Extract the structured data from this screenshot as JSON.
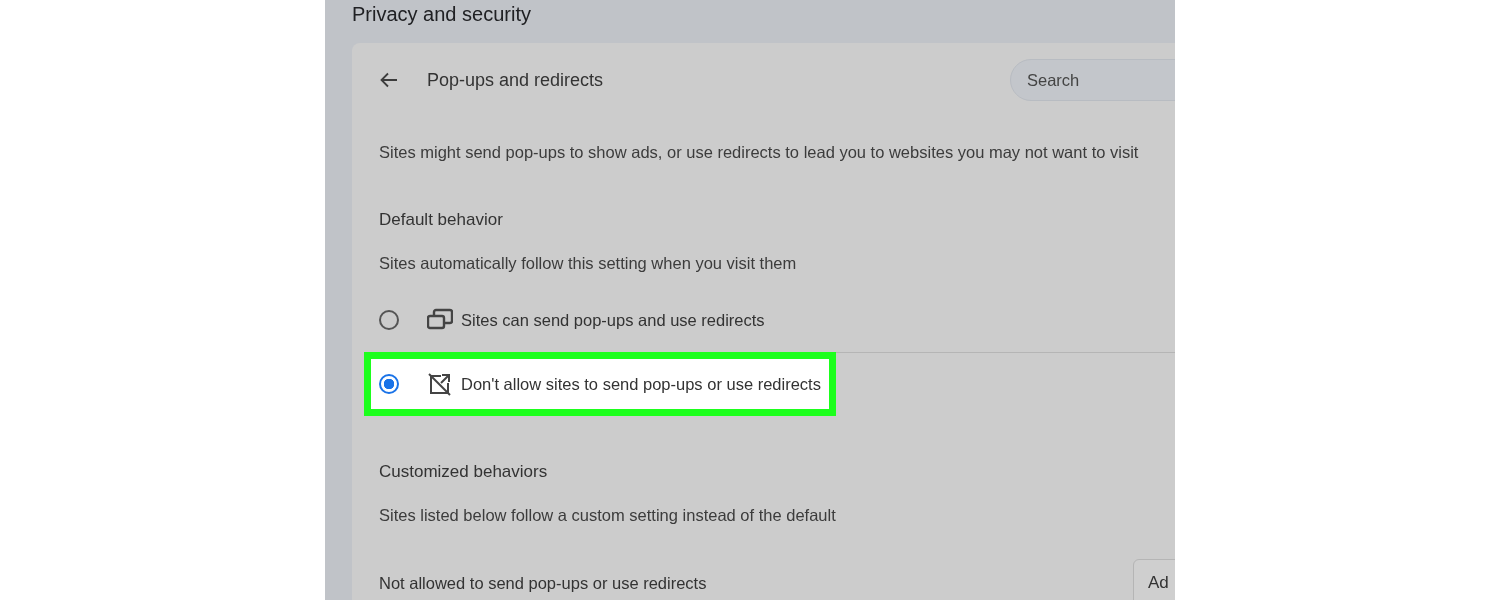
{
  "page_title": "Privacy and security",
  "header": {
    "title": "Pop-ups and redirects",
    "search": {
      "placeholder": "Search"
    }
  },
  "description": "Sites might send pop-ups to show ads, or use redirects to lead you to websites you may not want to visit",
  "default_behavior": {
    "heading": "Default behavior",
    "subtitle": "Sites automatically follow this setting when you visit them",
    "options": [
      {
        "kind": "allow",
        "label": "Sites can send pop-ups and use redirects",
        "selected": false,
        "highlighted": false
      },
      {
        "kind": "block",
        "label": "Don't allow sites to send pop-ups or use redirects",
        "selected": true,
        "highlighted": true
      }
    ]
  },
  "customized_behaviors": {
    "heading": "Customized behaviors",
    "subtitle": "Sites listed below follow a custom setting instead of the default",
    "lists": [
      {
        "label": "Not allowed to send pop-ups or use redirects",
        "button": "Ad"
      }
    ]
  }
}
